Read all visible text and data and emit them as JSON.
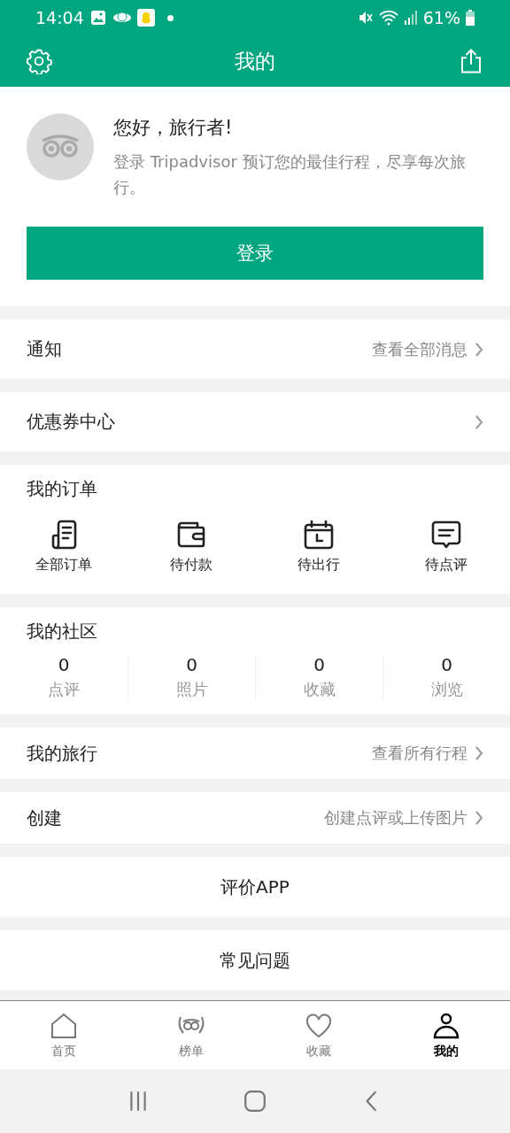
{
  "status_bar": {
    "time": "14:04",
    "battery": "61%"
  },
  "header": {
    "title": "我的"
  },
  "profile": {
    "greeting": "您好，旅行者!",
    "message": "登录 Tripadvisor 预订您的最佳行程，尽享每次旅行。",
    "login_button": "登录"
  },
  "notifications": {
    "label": "通知",
    "link": "查看全部消息"
  },
  "coupons": {
    "label": "优惠券中心"
  },
  "orders": {
    "title": "我的订单",
    "items": [
      {
        "kind": "document",
        "label": "全部订单"
      },
      {
        "kind": "wallet",
        "label": "待付款"
      },
      {
        "kind": "calendar",
        "label": "待出行"
      },
      {
        "kind": "comment",
        "label": "待点评"
      }
    ]
  },
  "community": {
    "title": "我的社区",
    "stats": [
      {
        "count": "0",
        "label": "点评"
      },
      {
        "count": "0",
        "label": "照片"
      },
      {
        "count": "0",
        "label": "收藏"
      },
      {
        "count": "0",
        "label": "浏览"
      }
    ]
  },
  "trips": {
    "label": "我的旅行",
    "link": "查看所有行程"
  },
  "create": {
    "label": "创建",
    "link": "创建点评或上传图片"
  },
  "rate_app": {
    "label": "评价APP"
  },
  "faq": {
    "label": "常见问题"
  },
  "tab_bar": [
    {
      "kind": "home",
      "label": "首页",
      "selected": false
    },
    {
      "kind": "owl",
      "label": "榜单",
      "selected": false
    },
    {
      "kind": "heart",
      "label": "收藏",
      "selected": false
    },
    {
      "kind": "person",
      "label": "我的",
      "selected": true
    }
  ]
}
